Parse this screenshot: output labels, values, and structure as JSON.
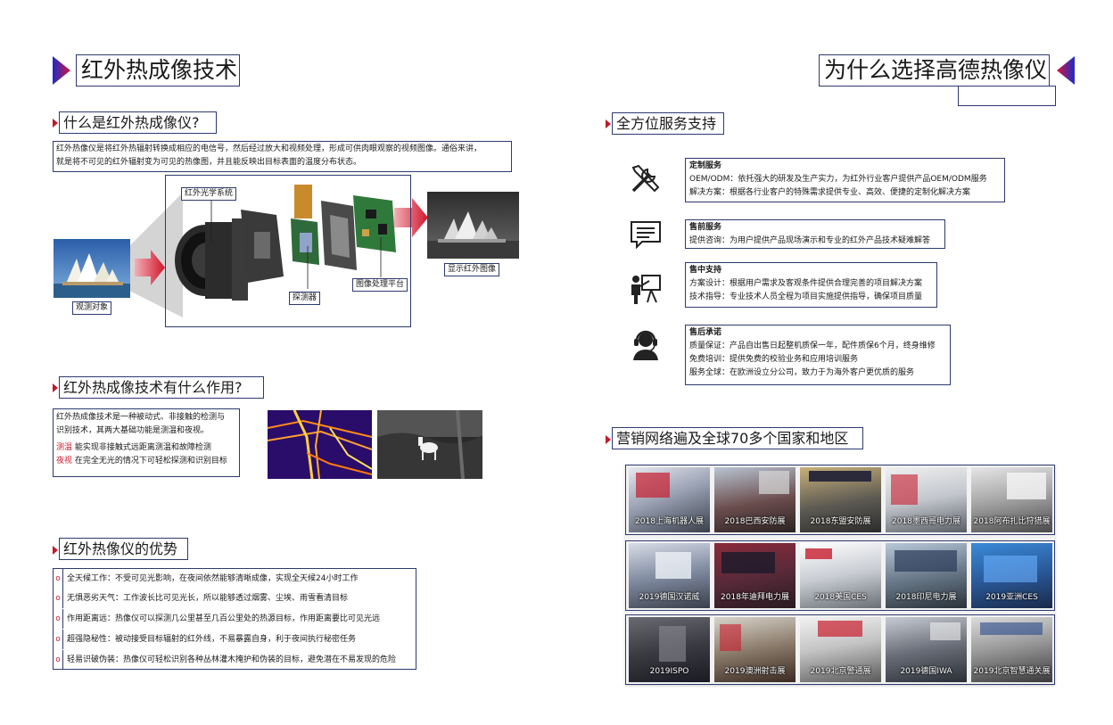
{
  "left": {
    "main_title": "红外热成像技术",
    "s1": {
      "title": "什么是红外热成像仪?",
      "desc_lines": [
        "红外热像仪是将红外热辐射转换成相应的电信号，然后经过放大和视频处理，形成可供肉眼观察的视频图像。通俗来讲，",
        "就是将不可见的红外辐射变为可见的热像图，并且能反映出目标表面的温度分布状态。"
      ],
      "labels": {
        "optics": "红外光学系统",
        "object": "观测对象",
        "detector": "探测器",
        "processing": "图像处理平台",
        "display": "显示红外图像"
      }
    },
    "s2": {
      "title": "红外热成像技术有什么作用?",
      "desc_lines": [
        "红外热成像技术是一种被动式、非接触的检测与",
        "识别技术，其两大基础功能是测温和夜视。"
      ],
      "items": [
        {
          "key": "测温",
          "text": "能实现非接触式远距离测温和故障检测"
        },
        {
          "key": "夜视",
          "text": "在完全无光的情况下可轻松探测和识别目标"
        }
      ]
    },
    "s3": {
      "title": "红外热像仪的优势",
      "marker": "o",
      "items": [
        "全天候工作：不受可见光影响，在夜间依然能够清晰成像，实现全天候24小时工作",
        "无惧恶劣天气：工作波长比可见光长，所以能够透过烟雾、尘埃、雨雪看清目标",
        "作用距离远：热像仪可以探测几公里甚至几百公里处的热源目标，作用距离要比可见光远",
        "超强隐秘性：被动接受目标辐射的红外线，不易暴露自身，利于夜间执行秘密任务",
        "轻易识破伪装：热像仪可轻松识别各种丛林灌木掩护和伪装的目标，避免潜在不易发现的危险"
      ]
    }
  },
  "right": {
    "main_title": "为什么选择高德热像仪",
    "s1": {
      "title": "全方位服务支持",
      "services": [
        {
          "icon": "tools-icon",
          "title": "定制服务",
          "lines": [
            "OEM/ODM：依托强大的研发及生产实力，为红外行业客户提供产品OEM/ODM服务",
            "解决方案：根据各行业客户的特殊需求提供专业、高效、便捷的定制化解决方案"
          ]
        },
        {
          "icon": "chat-icon",
          "title": "售前服务",
          "lines": [
            "提供咨询：为用户提供产品现场演示和专业的红外产品技术疑难解答"
          ]
        },
        {
          "icon": "presentation-icon",
          "title": "售中支持",
          "lines": [
            "方案设计：根据用户需求及客观条件提供合理完善的项目解决方案",
            "技术指导：专业技术人员全程为项目实施提供指导，确保项目质量"
          ]
        },
        {
          "icon": "headset-icon",
          "title": "售后承诺",
          "lines": [
            "质量保证：产品自出售日起整机质保一年，配件质保6个月，终身维修",
            "免费培训：提供免费的校验业务和应用培训服务",
            "服务全球：在欧洲设立分公司，致力于为海外客户更优质的服务"
          ]
        }
      ]
    },
    "s2": {
      "title": "营销网络遍及全球70多个国家和地区",
      "rows": [
        [
          "2018上海机器人展",
          "2018巴西安防展",
          "2018东盟安防展",
          "2018墨西哥电力展",
          "2018阿布扎比狩猎展"
        ],
        [
          "2019德国汉诺威",
          "2018年迪拜电力展",
          "2018美国CES",
          "2018印尼电力展",
          "2019亚洲CES"
        ],
        [
          "2019ISPO",
          "2019澳洲射击展",
          "2019北京警通展",
          "2019德国IWA",
          "2019北京智慧通关展"
        ]
      ]
    }
  },
  "colors": {
    "accent_red": "#c81e2e",
    "accent_blue": "#2e3a6e",
    "gradient_from": "#1c2cc8",
    "gradient_to": "#d2143c"
  }
}
